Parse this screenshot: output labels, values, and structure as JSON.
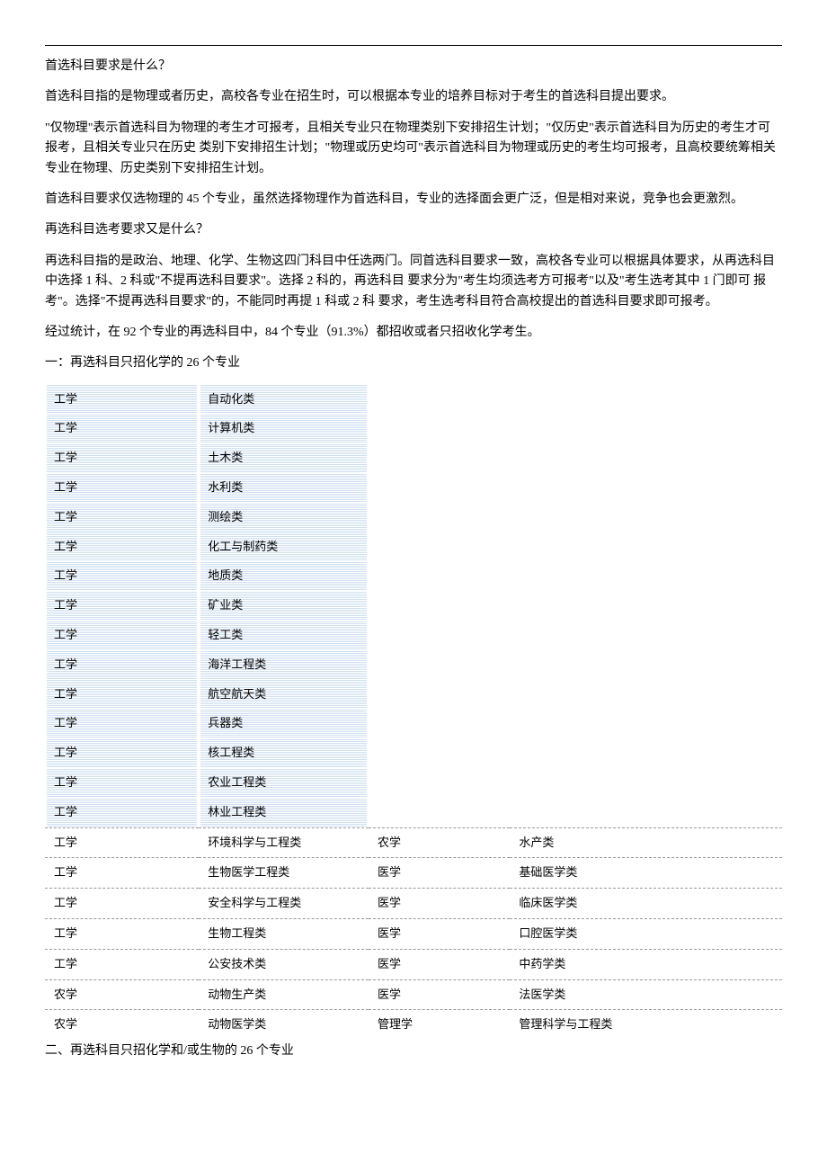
{
  "paragraphs": {
    "p1": "首选科目要求是什么？",
    "p2": "首选科目指的是物理或者历史，高校各专业在招生时，可以根据本专业的培养目标对于考生的首选科目提出要求。",
    "p3": "\"仅物理\"表示首选科目为物理的考生才可报考，且相关专业只在物理类别下安排招生计划；\"仅历史\"表示首选科目为历史的考生才可报考，且相关专业只在历史 类别下安排招生计划；\"物理或历史均可\"表示首选科目为物理或历史的考生均可报考，且高校要统筹相关专业在物理、历史类别下安排招生计划。",
    "p4": "首选科目要求仅选物理的 45 个专业，虽然选择物理作为首选科目，专业的选择面会更广泛，但是相对来说，竞争也会更激烈。",
    "p5": "再选科目选考要求又是什么？",
    "p6": "再选科目指的是政治、地理、化学、生物这四门科目中任选两门。同首选科目要求一致，高校各专业可以根据具体要求，从再选科目 中选择 1 科、2 科或\"不提再选科目要求\"。选择 2 科的，再选科目 要求分为\"考生均须选考方可报考\"以及\"考生选考其中 1 门即可 报考\"。选择\"不提再选科目要求\"的，不能同时再提 1 科或 2 科 要求，考生选考科目符合高校提出的首选科目要求即可报考。",
    "p7": "经过统计，在 92 个专业的再选科目中，84 个专业（91.3%）都招收或者只招收化学考生。",
    "h1": "一：再选科目只招化学的 26 个专业",
    "h2": "二、再选科目只招化学和/或生物的 26 个专业"
  },
  "table1": [
    {
      "c1": "工学",
      "c2": "自动化类"
    },
    {
      "c1": "工学",
      "c2": "计算机类"
    },
    {
      "c1": "工学",
      "c2": "土木类"
    },
    {
      "c1": "工学",
      "c2": "水利类"
    },
    {
      "c1": "工学",
      "c2": "测绘类"
    },
    {
      "c1": "工学",
      "c2": "化工与制药类"
    },
    {
      "c1": "工学",
      "c2": "地质类"
    },
    {
      "c1": "工学",
      "c2": "矿业类"
    },
    {
      "c1": "工学",
      "c2": "轻工类"
    },
    {
      "c1": "工学",
      "c2": "海洋工程类"
    },
    {
      "c1": "工学",
      "c2": "航空航天类"
    },
    {
      "c1": "工学",
      "c2": "兵器类"
    },
    {
      "c1": "工学",
      "c2": "核工程类"
    },
    {
      "c1": "工学",
      "c2": "农业工程类"
    },
    {
      "c1": "工学",
      "c2": "林业工程类"
    },
    {
      "c1": "工学",
      "c2": "环境科学与工程类"
    },
    {
      "c1": "工学",
      "c2": "生物医学工程类"
    },
    {
      "c1": "工学",
      "c2": "安全科学与工程类"
    },
    {
      "c1": "工学",
      "c2": "生物工程类"
    },
    {
      "c1": "工学",
      "c2": "公安技术类"
    },
    {
      "c1": "农学",
      "c2": "动物生产类"
    },
    {
      "c1": "农学",
      "c2": "动物医学类"
    }
  ],
  "table2": [
    {
      "c1": "农学",
      "c2": "水产类"
    },
    {
      "c1": "医学",
      "c2": "基础医学类"
    },
    {
      "c1": "医学",
      "c2": "临床医学类"
    },
    {
      "c1": "医学",
      "c2": "口腔医学类"
    },
    {
      "c1": "医学",
      "c2": "中药学类"
    },
    {
      "c1": "医学",
      "c2": "法医学类"
    },
    {
      "c1": "管理学",
      "c2": "管理科学与工程类"
    }
  ]
}
